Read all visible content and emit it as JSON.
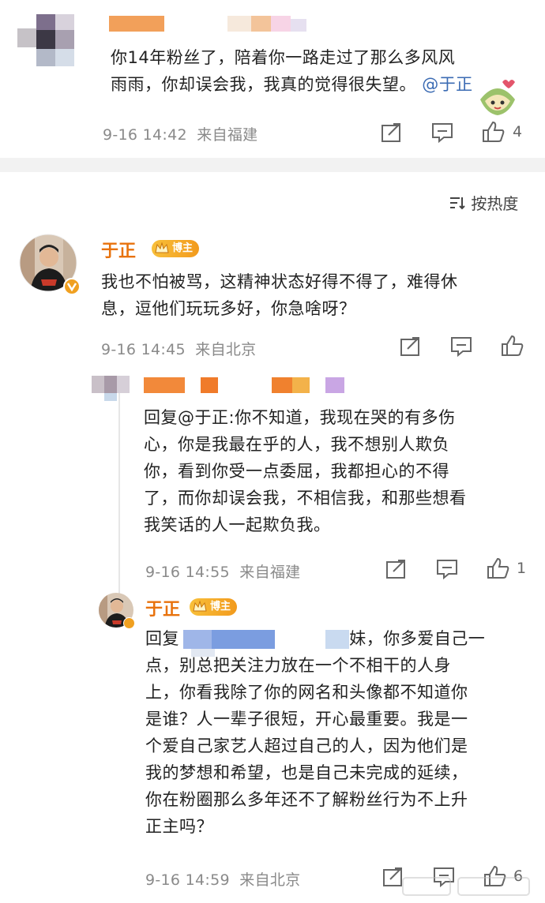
{
  "top_comment": {
    "text_line1": "你14年粉丝了，陪着你一路走过了那么多风风",
    "text_line2": "雨雨，你却误会我，我真的觉得很失望。",
    "mention": "@于正",
    "time": "9-16 14:42",
    "location": "来自福建",
    "like_count": "4"
  },
  "sort": {
    "label": "按热度"
  },
  "main_comment": {
    "author": "于正",
    "badge": "博主",
    "text_line1": "我也不怕被骂，这精神状态好得不得了，难得休",
    "text_line2": "息，逗他们玩玩多好，你急啥呀？",
    "time": "9-16 14:45",
    "location": "来自北京"
  },
  "reply1": {
    "text_line1": "回复@于正:你不知道，我现在哭的有多伤",
    "text_line2": "心，你是我最在乎的人，我不想别人欺负",
    "text_line3": "你，看到你受一点委屈，我都担心的不得",
    "text_line4": "了，而你却误会我，不相信我，和那些想看",
    "text_line5": "我笑话的人一起欺负我。",
    "time": "9-16 14:55",
    "location": "来自福建",
    "like_count": "1"
  },
  "reply2": {
    "author": "于正",
    "badge": "博主",
    "text_line1": "回复                              妹，你多爱自己一",
    "text_line2": "点，别总把关注力放在一个不相干的人身",
    "text_line3": "上，你看我除了你的网名和头像都不知道你",
    "text_line4": "是谁？人一辈子很短，开心最重要。我是一",
    "text_line5": "个爱自己家艺人超过自己的人，因为他们是",
    "text_line6": "我的梦想和希望，也是自己未完成的延续，",
    "text_line7": "你在粉圈那么多年还不了解粉丝行为不上升",
    "text_line8": "正主吗？",
    "time": "9-16 14:59",
    "location": "来自北京",
    "like_count": "6"
  },
  "colors": {
    "orange": "#e8720c",
    "link": "#3b6bb3",
    "meta": "#8a8a8a"
  }
}
